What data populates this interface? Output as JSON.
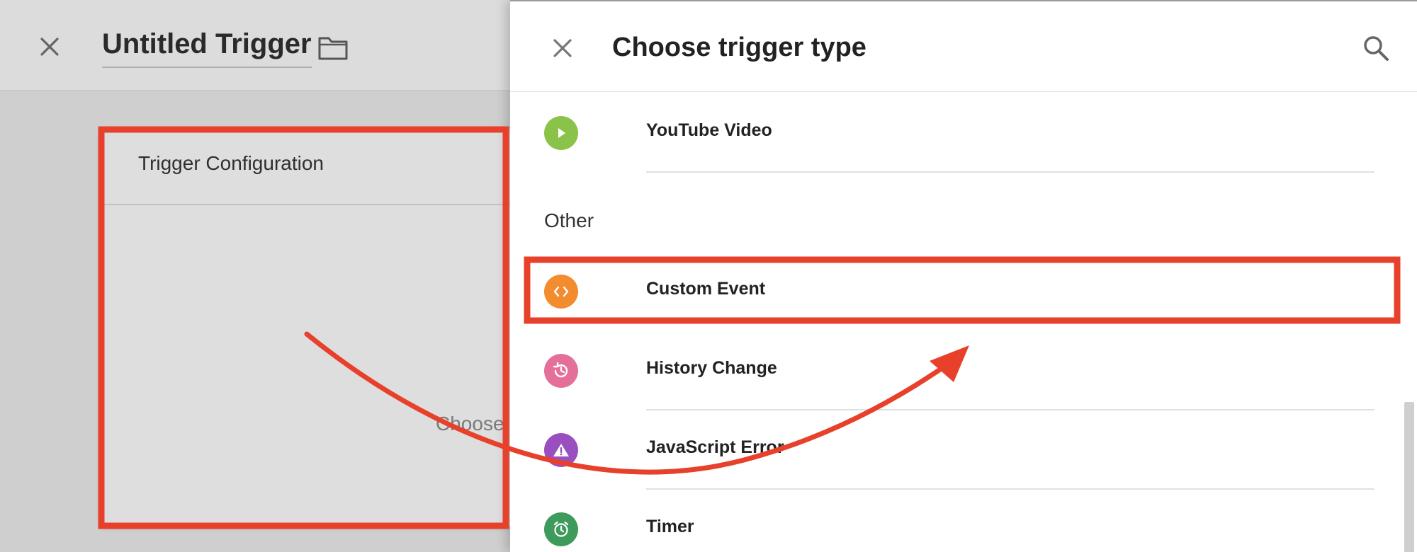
{
  "background_editor": {
    "title": "Untitled Trigger",
    "card_title": "Trigger Configuration",
    "card_hint": "Choose"
  },
  "panel": {
    "title": "Choose trigger type",
    "items": [
      {
        "label": "YouTube Video",
        "icon": "play-icon",
        "color": "#8bc34a"
      },
      {
        "label": "Custom Event",
        "icon": "code-icon",
        "color": "#f28c2f"
      },
      {
        "label": "History Change",
        "icon": "history-icon",
        "color": "#e4709a"
      },
      {
        "label": "JavaScript Error",
        "icon": "warning-icon",
        "color": "#9a4fc1"
      },
      {
        "label": "Timer",
        "icon": "alarm-clock-icon",
        "color": "#3e9b5c"
      }
    ],
    "section_other": "Other"
  },
  "annotation": {
    "highlight_color": "#e8412b"
  }
}
